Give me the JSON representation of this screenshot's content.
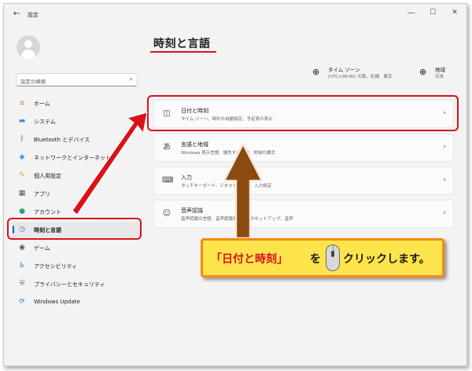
{
  "window": {
    "back_glyph": "←",
    "title": "設定",
    "min_glyph": "—",
    "max_glyph": "☐",
    "close_glyph": "✕"
  },
  "search": {
    "placeholder": "設定の検索"
  },
  "sidebar": {
    "items": [
      {
        "label": "ホーム",
        "icon": "home-icon",
        "color": "#c96b2a"
      },
      {
        "label": "システム",
        "icon": "system-icon",
        "color": "#3a8fd8"
      },
      {
        "label": "Bluetooth とデバイス",
        "icon": "bluetooth-icon",
        "color": "#1f6fd0"
      },
      {
        "label": "ネットワークとインターネット",
        "icon": "network-icon",
        "color": "#4a9fe0"
      },
      {
        "label": "個人用設定",
        "icon": "brush-icon",
        "color": "#e49a2a"
      },
      {
        "label": "アプリ",
        "icon": "apps-icon",
        "color": "#555555"
      },
      {
        "label": "アカウント",
        "icon": "account-icon",
        "color": "#2aa36a"
      },
      {
        "label": "時刻と言語",
        "icon": "time-language-icon",
        "color": "#2e7bd6"
      },
      {
        "label": "ゲーム",
        "icon": "game-icon",
        "color": "#555555"
      },
      {
        "label": "アクセシビリティ",
        "icon": "accessibility-icon",
        "color": "#2e7bd6"
      },
      {
        "label": "プライバシーとセキュリティ",
        "icon": "shield-icon",
        "color": "#666666"
      },
      {
        "label": "Windows Update",
        "icon": "update-icon",
        "color": "#2e7bd6"
      }
    ]
  },
  "main": {
    "title": "時刻と言語",
    "timezone": {
      "label": "タイム ゾーン",
      "value": "(UTC+09:00) 大阪、札幌、東京"
    },
    "region": {
      "label": "地域",
      "value": "日本"
    },
    "cards": [
      {
        "title": "日付と時刻",
        "desc": "タイム ゾーン、時計の自動設定、予定表の表示",
        "icon": "calendar-clock-icon"
      },
      {
        "title": "言語と地域",
        "desc": "Windows 表示言語、優先する言語、地域の書式",
        "icon": "language-icon"
      },
      {
        "title": "入力",
        "desc": "タッチキーボード、テキストの候補、入力設定",
        "icon": "keyboard-icon"
      },
      {
        "title": "音声認識",
        "desc": "音声認識の言語、音声認識用マイクのセットアップ、音声",
        "icon": "speech-icon"
      }
    ]
  },
  "callout": {
    "part1": "「日付と時刻」",
    "part2": "を",
    "part3": "クリックします。"
  },
  "colors": {
    "highlight": "#d8121b",
    "arrow": "#8a4a10",
    "callout_bg": "#fde44c",
    "callout_border": "#f18b10",
    "accent": "#0067c0"
  }
}
